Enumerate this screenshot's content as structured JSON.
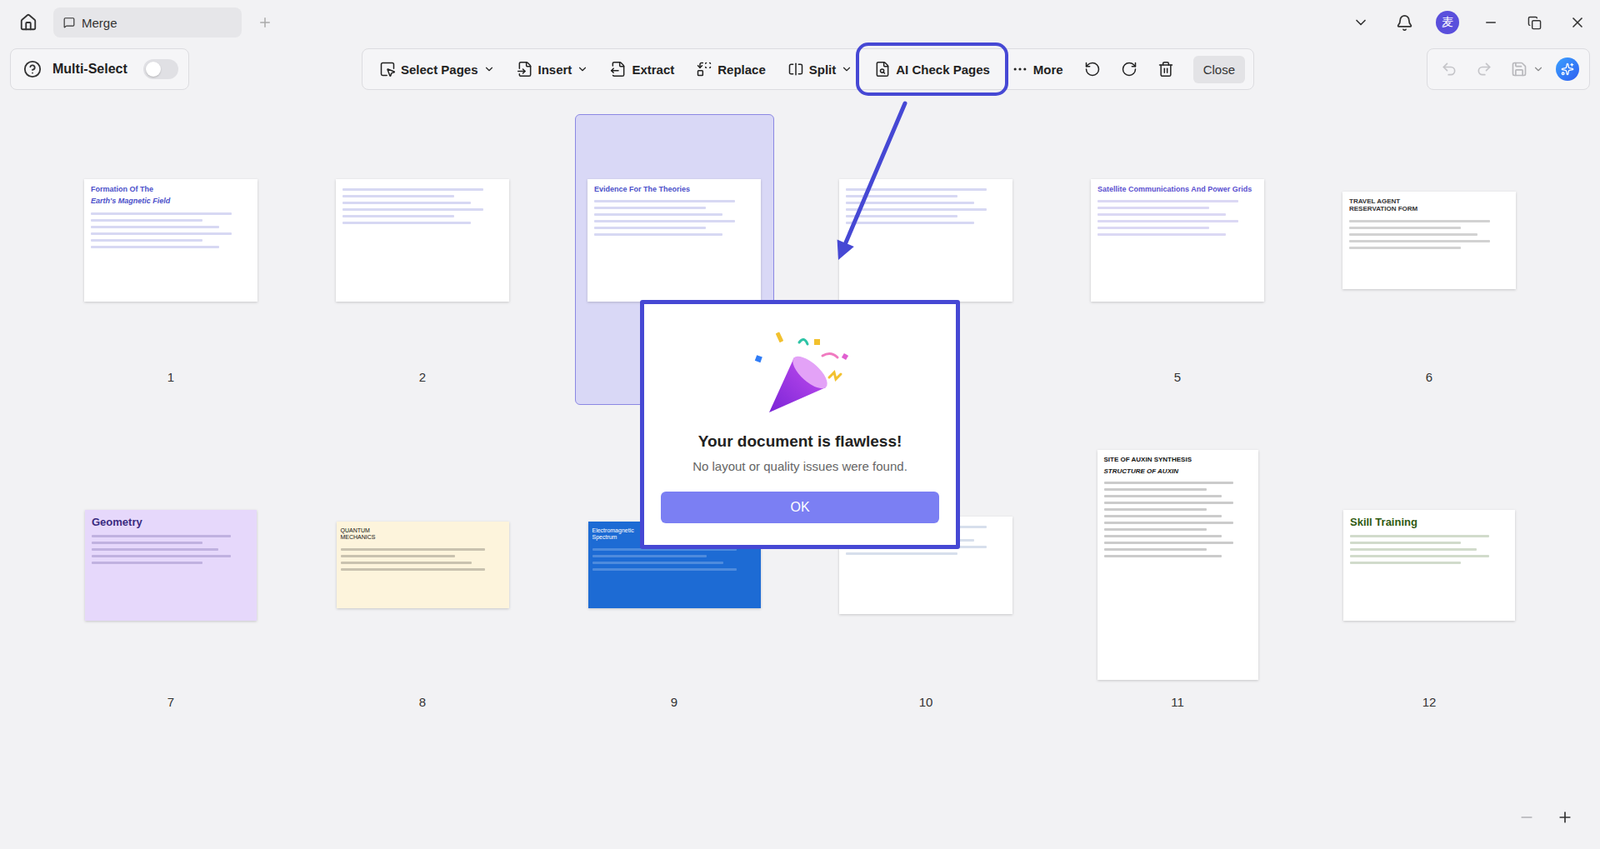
{
  "window": {
    "tab": "Merge"
  },
  "account": {
    "avatar": "麦"
  },
  "multi_select": {
    "label": "Multi-Select",
    "on": false
  },
  "toolbar": [
    {
      "label": "Select Pages",
      "kind": "text",
      "dropdown": true,
      "highlighted": false
    },
    {
      "label": "Insert",
      "kind": "text",
      "dropdown": true,
      "highlighted": false
    },
    {
      "label": "Extract",
      "kind": "text",
      "dropdown": false,
      "highlighted": false
    },
    {
      "label": "Replace",
      "kind": "text",
      "dropdown": false,
      "highlighted": false
    },
    {
      "label": "Split",
      "kind": "text",
      "dropdown": true,
      "highlighted": false
    },
    {
      "label": "AI Check Pages",
      "kind": "text",
      "dropdown": false,
      "highlighted": true
    },
    {
      "label": "More",
      "kind": "text",
      "dropdown": false,
      "highlighted": false
    },
    {
      "kind": "icon",
      "dropdown": false,
      "highlighted": false
    },
    {
      "kind": "icon",
      "dropdown": false,
      "highlighted": false
    },
    {
      "kind": "icon",
      "dropdown": false,
      "highlighted": false
    },
    {
      "label": "Close",
      "kind": "button",
      "dropdown": false,
      "highlighted": false
    }
  ],
  "history": {
    "undo_disabled": true,
    "redo_disabled": true,
    "save_disabled": true
  },
  "pages": [
    {
      "number": "1",
      "title": "Formation Of The",
      "subtitle": "Earth's Magnetic Field",
      "kind": "page",
      "selected": false,
      "background": "#ffffff",
      "color": "#4b4fc9"
    },
    {
      "number": "2",
      "kind": "page",
      "selected": false,
      "background": "#ffffff",
      "color": "#4b4fc9"
    },
    {
      "title": "Evidence For The Theories",
      "kind": "page",
      "selected": true,
      "background": "#ffffff",
      "color": "#4b4fc9"
    },
    {
      "kind": "page",
      "selected": false,
      "background": "#ffffff",
      "color": "#4b4fc9"
    },
    {
      "number": "5",
      "title": "Satellite Communications And Power Grids",
      "kind": "page",
      "selected": false,
      "background": "#ffffff",
      "color": "#5a4fcf"
    },
    {
      "number": "6",
      "title": "TRAVEL AGENT RESERVATION FORM",
      "kind": "wide",
      "selected": false,
      "background": "#ffffff",
      "color": "#333333"
    },
    {
      "number": "7",
      "title": "Geometry",
      "kind": "slide",
      "selected": false,
      "background": "#e6d8fb",
      "color": "#3a2b80"
    },
    {
      "number": "8",
      "title": "QUANTUM MECHANICS",
      "kind": "strip",
      "selected": false,
      "background": "#fdf4dc",
      "color": "#111111"
    },
    {
      "number": "9",
      "title": "Electromagnetic Spectrum",
      "kind": "strip",
      "selected": false,
      "background": "#1d6bd4",
      "color": "#ffffff"
    },
    {
      "number": "10",
      "kind": "wide",
      "selected": false,
      "background": "#ffffff",
      "color": "#4a6fa8"
    },
    {
      "number": "11",
      "title": "SITE OF AUXIN SYNTHESIS",
      "subtitle": "STRUCTURE OF AUXIN",
      "kind": "portrait",
      "selected": false,
      "background": "#ffffff",
      "color": "#111111"
    },
    {
      "number": "12",
      "title": "Skill Training",
      "kind": "slide",
      "selected": false,
      "background": "#ffffff",
      "color": "#2f5a12"
    }
  ],
  "dialog": {
    "title": "Your document is flawless!",
    "message": "No layout or quality issues were found.",
    "button": "OK"
  },
  "zoom": {
    "out_disabled": true,
    "in_disabled": false
  }
}
